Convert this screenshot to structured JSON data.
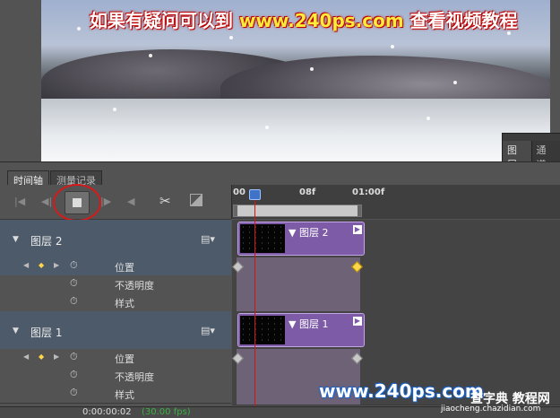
{
  "watermark": {
    "top_prefix": "如果有疑问可以到",
    "top_url": "www.240ps.com",
    "top_suffix": "查看视频教程",
    "bottom_url": "www.240ps.com",
    "site_name": "查字典 教程网",
    "site_url": "jiaocheng.chazidian.com"
  },
  "layers_panel": {
    "tabs": [
      "图层",
      "通道"
    ]
  },
  "timeline": {
    "tabs": [
      "时间轴",
      "测量记录"
    ],
    "ruler": {
      "ticks": [
        "00",
        "08f",
        "01:00f"
      ]
    },
    "layers": [
      {
        "name": "图层 2",
        "clip_label": "图层 2",
        "properties": [
          {
            "label": "位置",
            "selected": true,
            "keyframes": 2
          },
          {
            "label": "不透明度",
            "selected": false
          },
          {
            "label": "样式",
            "selected": false
          }
        ]
      },
      {
        "name": "图层 1",
        "clip_label": "图层 1",
        "properties": [
          {
            "label": "位置",
            "selected": false,
            "keyframes": 2
          },
          {
            "label": "不透明度",
            "selected": false
          },
          {
            "label": "样式",
            "selected": false
          }
        ]
      }
    ],
    "timecode": "0:00:00:02",
    "fps": "(30.00 fps)"
  },
  "colors": {
    "playhead": "#d21414",
    "clip": "#7d5ba6",
    "keyframe_active": "#ffd54a",
    "highlight_ring": "#d41b1b"
  }
}
